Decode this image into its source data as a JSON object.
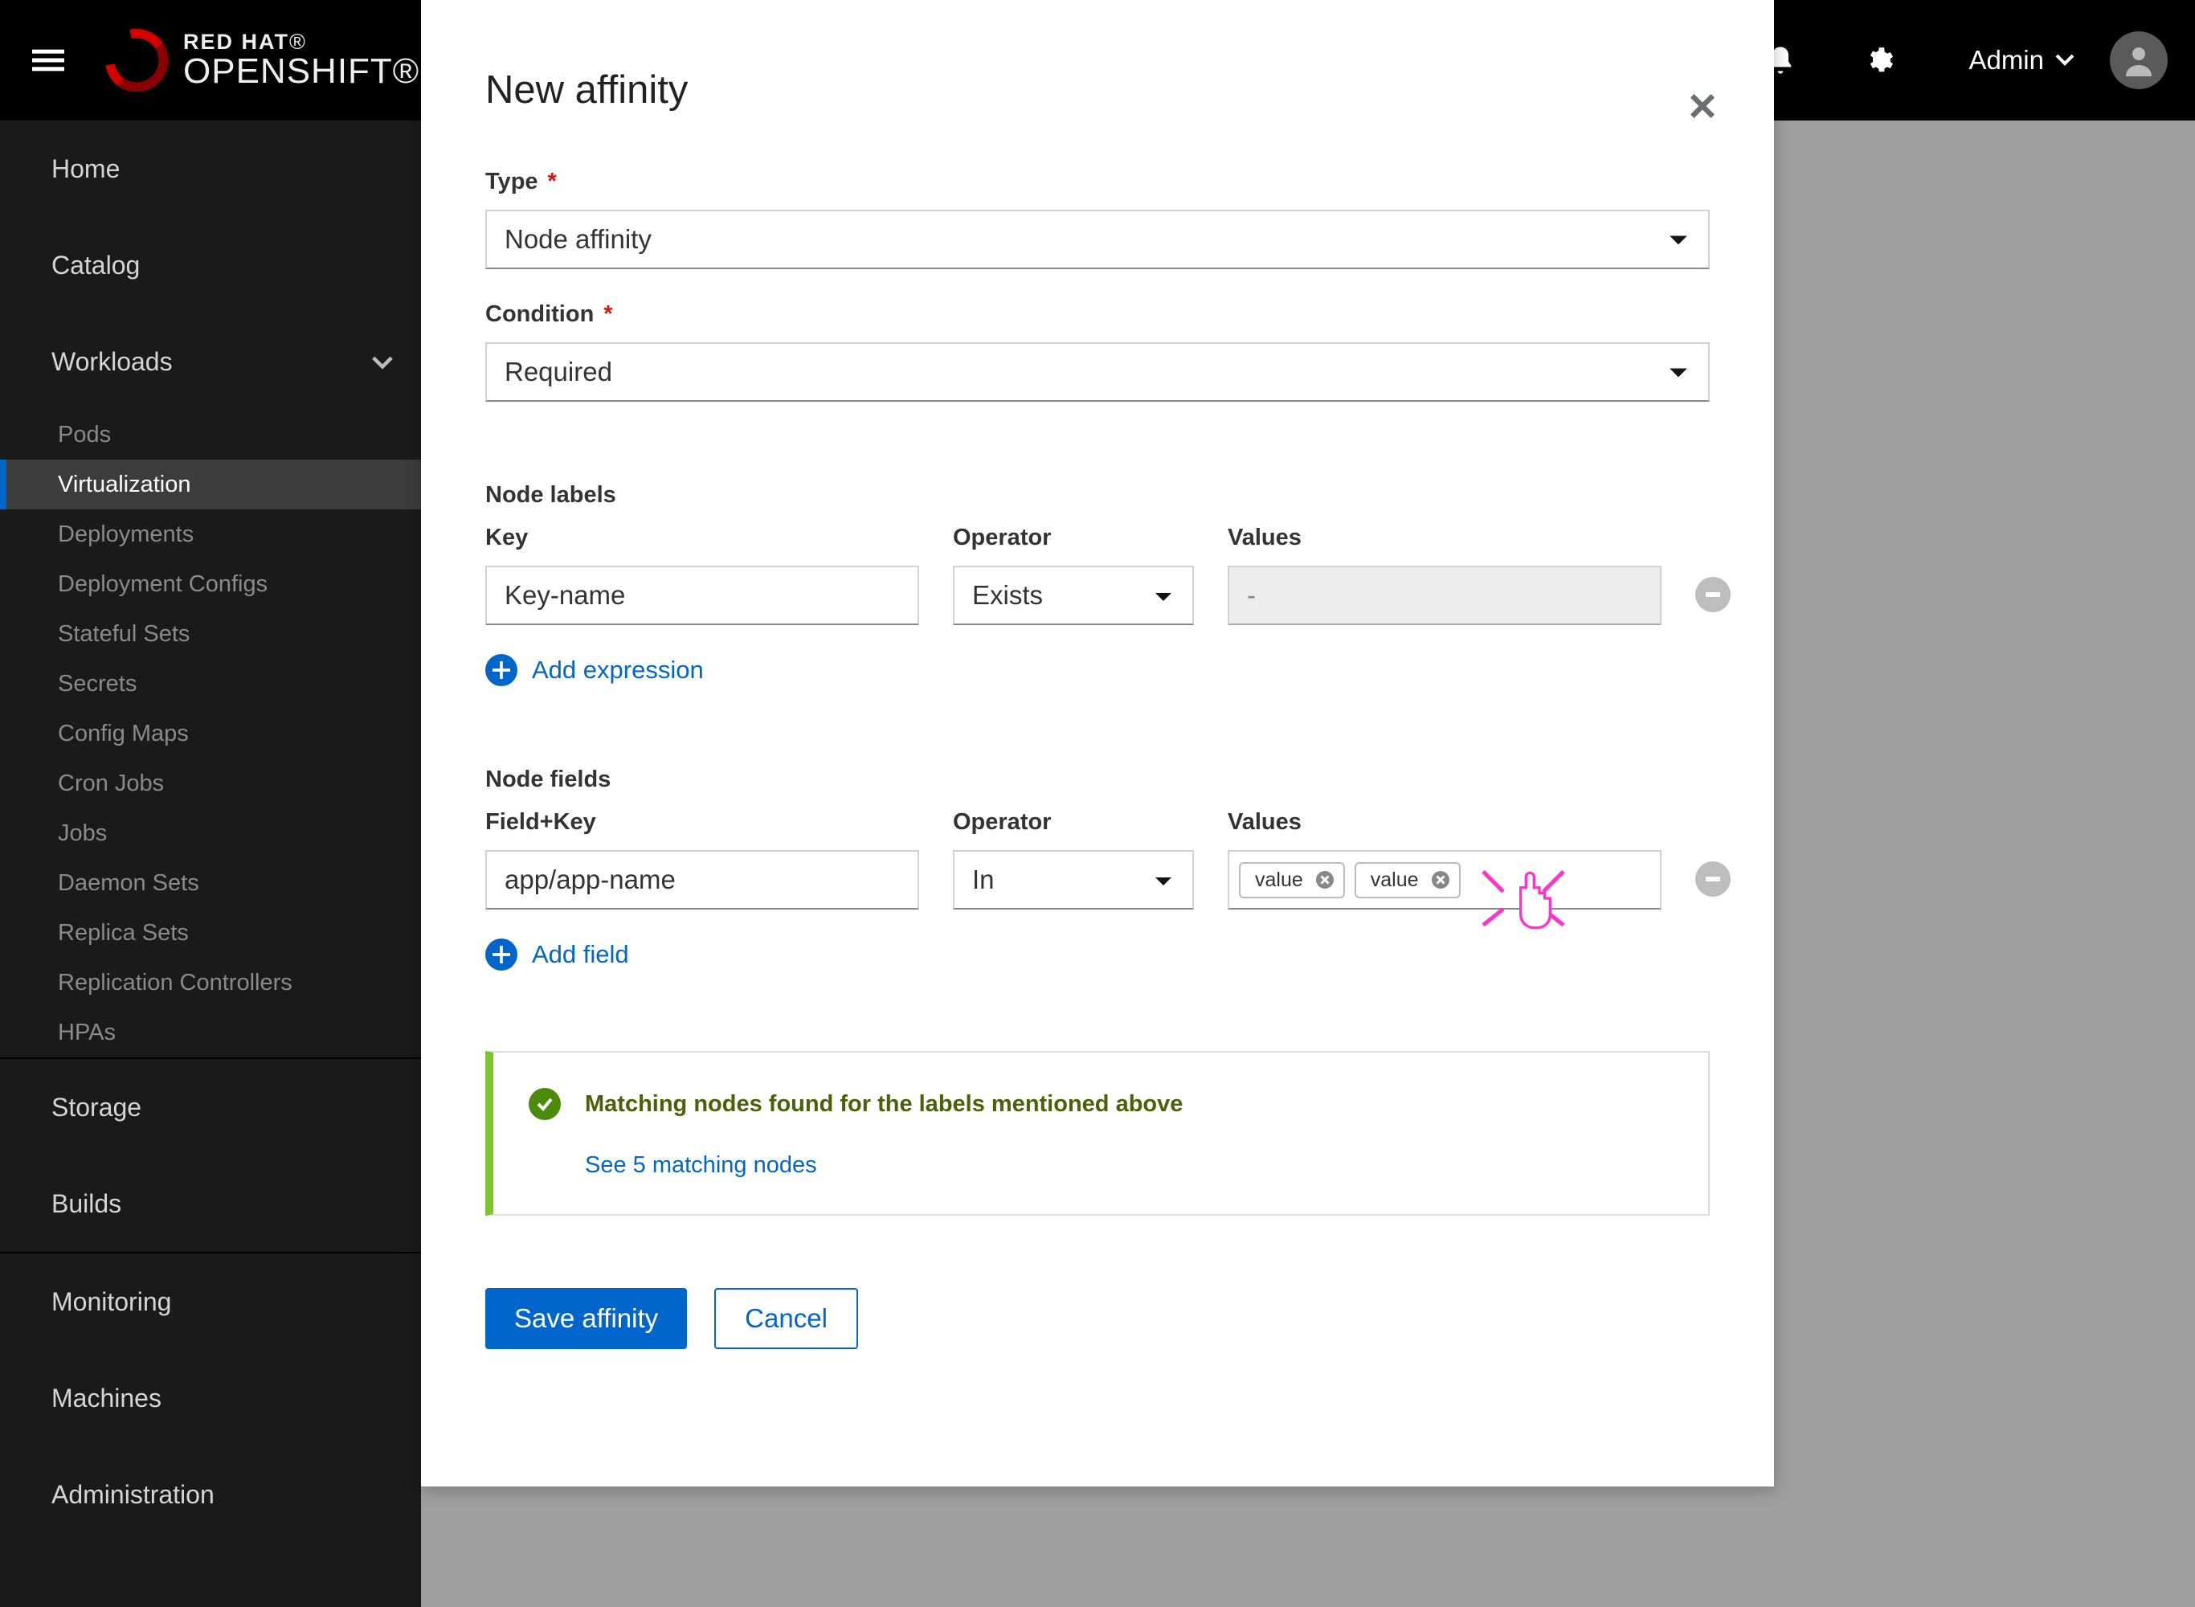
{
  "masthead": {
    "brand_top": "RED HAT",
    "brand_bot": "OPENSHIFT",
    "user_label": "Admin"
  },
  "sidebar": {
    "home": "Home",
    "catalog": "Catalog",
    "workloads": "Workloads",
    "workloads_items": [
      "Pods",
      "Virtualization",
      "Deployments",
      "Deployment Configs",
      "Stateful Sets",
      "Secrets",
      "Config Maps",
      "Cron Jobs",
      "Jobs",
      "Daemon Sets",
      "Replica Sets",
      "Replication Controllers",
      "HPAs"
    ],
    "storage": "Storage",
    "builds": "Builds",
    "monitoring": "Monitoring",
    "machines": "Machines",
    "administration": "Administration"
  },
  "modal": {
    "title": "New affinity",
    "type_label": "Type",
    "type_value": "Node affinity",
    "condition_label": "Condition",
    "condition_value": "Required",
    "node_labels_heading": "Node labels",
    "key_label": "Key",
    "operator_label": "Operator",
    "values_label": "Values",
    "nl_key_value": "Key-name",
    "nl_operator_value": "Exists",
    "nl_values_disabled": "-",
    "add_expression": "Add expression",
    "node_fields_heading": "Node fields",
    "fieldkey_label": "Field+Key",
    "nf_key_value": "app/app-name",
    "nf_operator_value": "In",
    "chip1": "value",
    "chip2": "value",
    "add_field": "Add field",
    "alert_title": "Matching nodes found for the labels mentioned above",
    "alert_link": "See 5 matching nodes",
    "save": "Save affinity",
    "cancel": "Cancel"
  }
}
